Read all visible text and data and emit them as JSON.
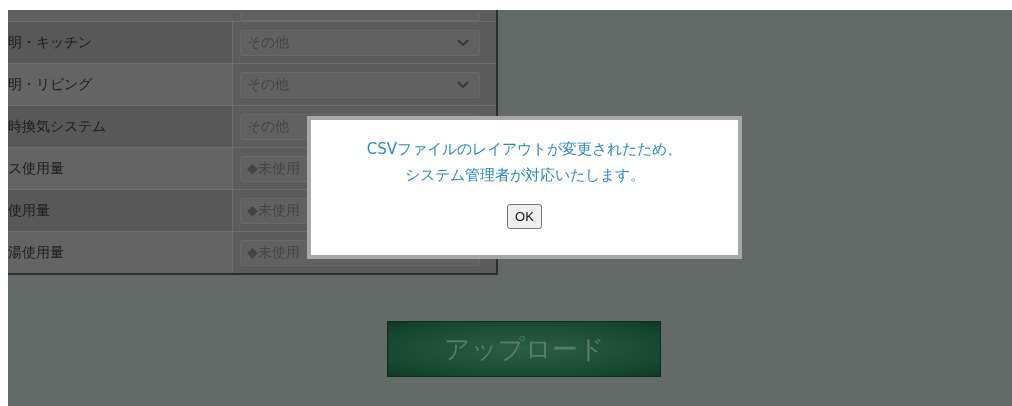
{
  "table": {
    "rows": [
      {
        "label": "明・キッチン",
        "value": "その他",
        "kind": "dropdown"
      },
      {
        "label": "明・リビング",
        "value": "その他",
        "kind": "dropdown"
      },
      {
        "label": "時換気システム",
        "value": "その他",
        "kind": "dropdown"
      },
      {
        "label": "ス使用量",
        "value": "◆未使用",
        "kind": "dropdown"
      },
      {
        "label": "使用量",
        "value": "◆未使用",
        "kind": "dropdown"
      },
      {
        "label": "湯使用量",
        "value": "◆未使用",
        "kind": "dropdown"
      }
    ]
  },
  "upload_button": {
    "label": "アップロード"
  },
  "dialog": {
    "message_lines": [
      "CSVファイルのレイアウトが変更されたため、",
      "システム管理者が対応いたします。"
    ],
    "button": "OK"
  }
}
